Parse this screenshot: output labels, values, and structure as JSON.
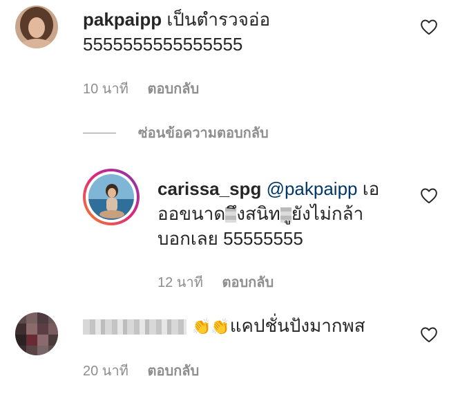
{
  "comments": [
    {
      "username": "pakpaipp",
      "text_line1": "เป็นตำรวจอ่อ",
      "text_line2": "5555555555555555",
      "time": "10 นาที",
      "reply_label": "ตอบกลับ"
    },
    {
      "username": "carissa_spg",
      "mention": "@pakpaipp",
      "text_line1_tail": "เอ",
      "text_line2_a": "ออขนาด",
      "text_line2_b": "ึงสนิท",
      "text_line2_c": "ูยังไม่กล้า",
      "text_line3": "บอกเลย 55555555",
      "time": "12 นาที",
      "reply_label": "ตอบกลับ"
    },
    {
      "username": "",
      "emoji": "👏👏",
      "text": "แคปชั่นปังมากพส",
      "time": "20 นาที",
      "reply_label": "ตอบกลับ"
    }
  ],
  "hide_replies_label": "ซ่อนข้อความตอบกลับ",
  "icons": {
    "like": "heart-icon"
  },
  "colors": {
    "text": "#262626",
    "secondary": "#8e8e8e",
    "mention": "#00376b",
    "story_ring_start": "#f58529",
    "story_ring_end": "#dd2a7b"
  }
}
